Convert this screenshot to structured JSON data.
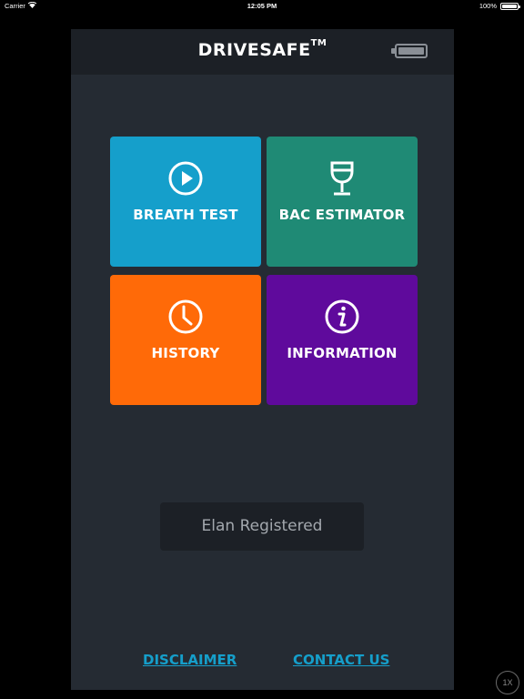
{
  "status_bar": {
    "carrier": "Carrier",
    "time": "12:05 PM",
    "battery_percent": "100%",
    "battery_level": 1.0
  },
  "header": {
    "title": "DRIVESAFE",
    "trademark": "TM",
    "battery_icon": "battery-icon"
  },
  "tiles": [
    {
      "label": "BREATH TEST",
      "icon": "play-circle-icon",
      "color": "#159fcb"
    },
    {
      "label": "BAC ESTIMATOR",
      "icon": "wine-glass-icon",
      "color": "#1f8a75"
    },
    {
      "label": "HISTORY",
      "icon": "clock-icon",
      "color": "#ff6a08"
    },
    {
      "label": "INFORMATION",
      "icon": "info-icon",
      "color": "#5f0a9c"
    }
  ],
  "device_status": "Elan Registered",
  "footer": {
    "disclaimer": "DISCLAIMER",
    "contact": "CONTACT US",
    "link_color": "#159fcb"
  },
  "zoom_button": "1X"
}
